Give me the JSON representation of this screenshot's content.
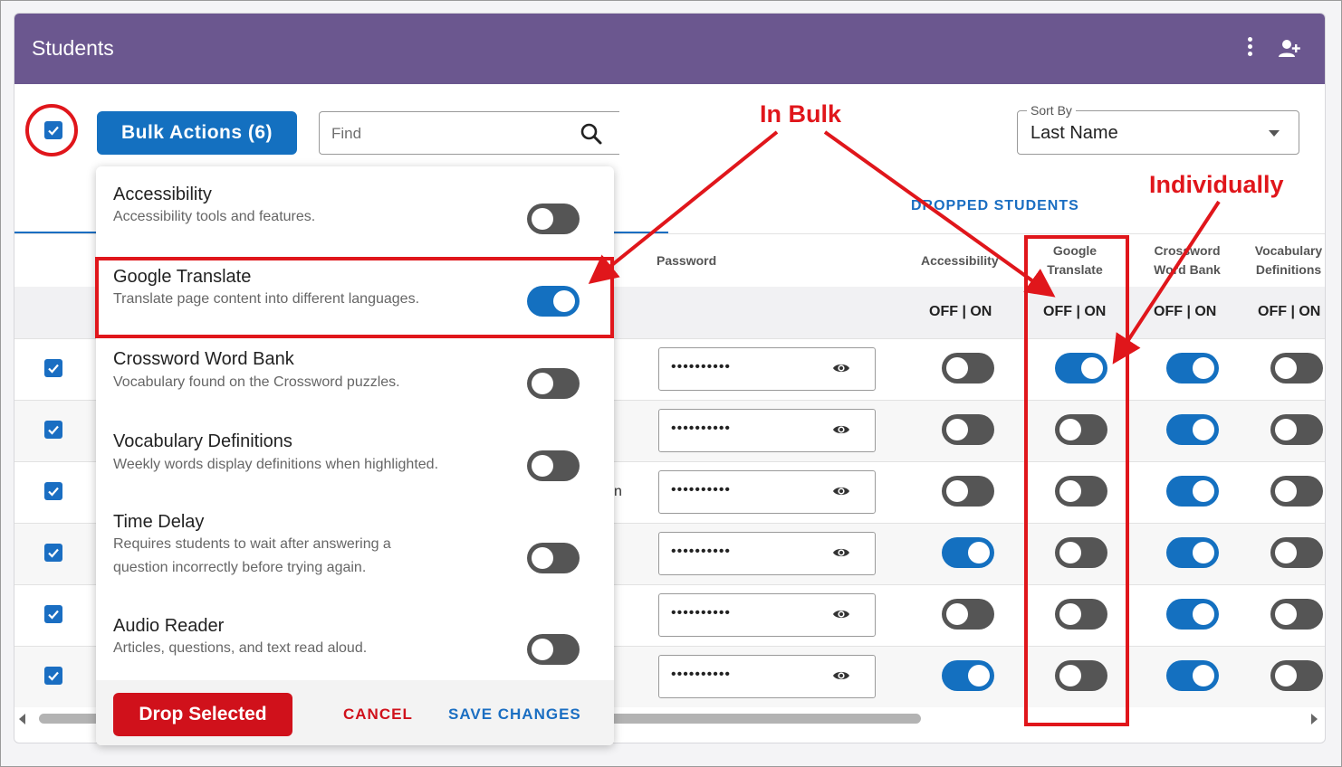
{
  "header": {
    "title": "Students"
  },
  "toolbar": {
    "bulk_actions_label": "Bulk Actions (6)",
    "find_placeholder": "Find",
    "sort_by": {
      "label": "Sort By",
      "value": "Last Name"
    }
  },
  "tabs": {
    "dropped_students": "DROPPED STUDENTS"
  },
  "columns": {
    "password": "Password",
    "accessibility": "Accessibility",
    "google_translate": [
      "Google",
      "Translate"
    ],
    "crossword_word_bank": [
      "Crossword",
      "Word Bank"
    ],
    "vocabulary_definitions": [
      "Vocabulary",
      "Definitions"
    ],
    "off_on": "OFF | ON"
  },
  "rows": [
    {
      "checked": true,
      "password": "••••••••••",
      "accessibility": false,
      "google_translate": true,
      "crossword": true,
      "vocabulary": false
    },
    {
      "checked": true,
      "password": "••••••••••",
      "accessibility": false,
      "google_translate": false,
      "crossword": true,
      "vocabulary": false
    },
    {
      "checked": true,
      "password": "••••••••••",
      "accessibility": false,
      "google_translate": false,
      "crossword": true,
      "vocabulary": false
    },
    {
      "checked": true,
      "password": "••••••••••",
      "accessibility": true,
      "google_translate": false,
      "crossword": true,
      "vocabulary": false
    },
    {
      "checked": true,
      "password": "••••••••••",
      "accessibility": false,
      "google_translate": false,
      "crossword": true,
      "vocabulary": false
    },
    {
      "checked": true,
      "password": "••••••••••",
      "accessibility": true,
      "google_translate": false,
      "crossword": true,
      "vocabulary": false
    }
  ],
  "partial_text": "n",
  "bulk_menu": {
    "items": [
      {
        "title": "Accessibility",
        "description": "Accessibility tools and features.",
        "on": false
      },
      {
        "title": "Google Translate",
        "description": "Translate page content into different languages.",
        "on": true
      },
      {
        "title": "Crossword Word Bank",
        "description": "Vocabulary found on the Crossword puzzles.",
        "on": false
      },
      {
        "title": "Vocabulary Definitions",
        "description": "Weekly words display definitions when highlighted.",
        "on": false
      },
      {
        "title": "Time Delay",
        "description_lines": [
          "Requires students to wait after answering a",
          "question incorrectly before trying again."
        ],
        "on": false
      },
      {
        "title": "Audio Reader",
        "description": "Articles, questions, and text read aloud.",
        "on": false
      }
    ],
    "drop_selected": "Drop Selected",
    "cancel": "CANCEL",
    "save_changes": "SAVE CHANGES"
  },
  "annotations": {
    "in_bulk": "In Bulk",
    "individually": "Individually",
    "color": "#e0161b"
  },
  "colors": {
    "header": "#6b578f",
    "primary": "#1470c0",
    "danger": "#d0111b"
  }
}
